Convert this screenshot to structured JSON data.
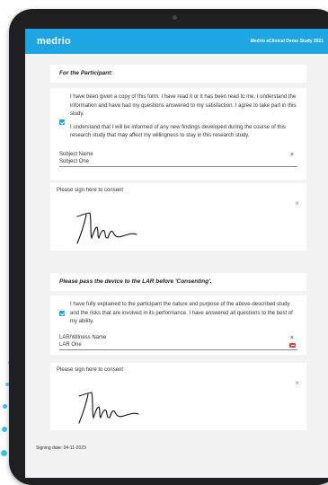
{
  "app": {
    "logo": "medrio",
    "study_title": "Medrio eClinical Demo Study 2021"
  },
  "participant_section": {
    "heading": "For the Participant:",
    "checkbox_checked": true,
    "paragraphs": [
      "I have been given a copy of this form. I have read it or it has been read to me. I understand the information and have had my questions answered to my satisfaction. I agree to take part in this study.",
      "I understand that I will be informed of any new findings developed during the course of this research study that may affect my willingness to stay in this research study."
    ],
    "subject_name_label": "Subject Name",
    "subject_name_value": "Subject One",
    "clear_icon": "×"
  },
  "participant_signature": {
    "label": "Please sign here to consent",
    "clear_icon": "×"
  },
  "lar_section": {
    "heading": "Please pass the device to the LAR before 'Consenting'.",
    "checkbox_checked": true,
    "paragraph": "I have fully explained to the participant the nature and purpose of the above-described study and the risks that are involved in its performance. I have answered all questions to the best of my ability.",
    "name_label": "LAR/Witness Name",
    "name_value": "LAR One",
    "clear_icon": "×"
  },
  "lar_signature": {
    "label": "Please sign here to consent",
    "clear_icon": "×"
  },
  "footer": {
    "signing_date": "Signing date: 04-11-2023"
  },
  "colors": {
    "accent": "#1ea6e4",
    "error": "#d64541",
    "background": "#f2f2f2"
  }
}
